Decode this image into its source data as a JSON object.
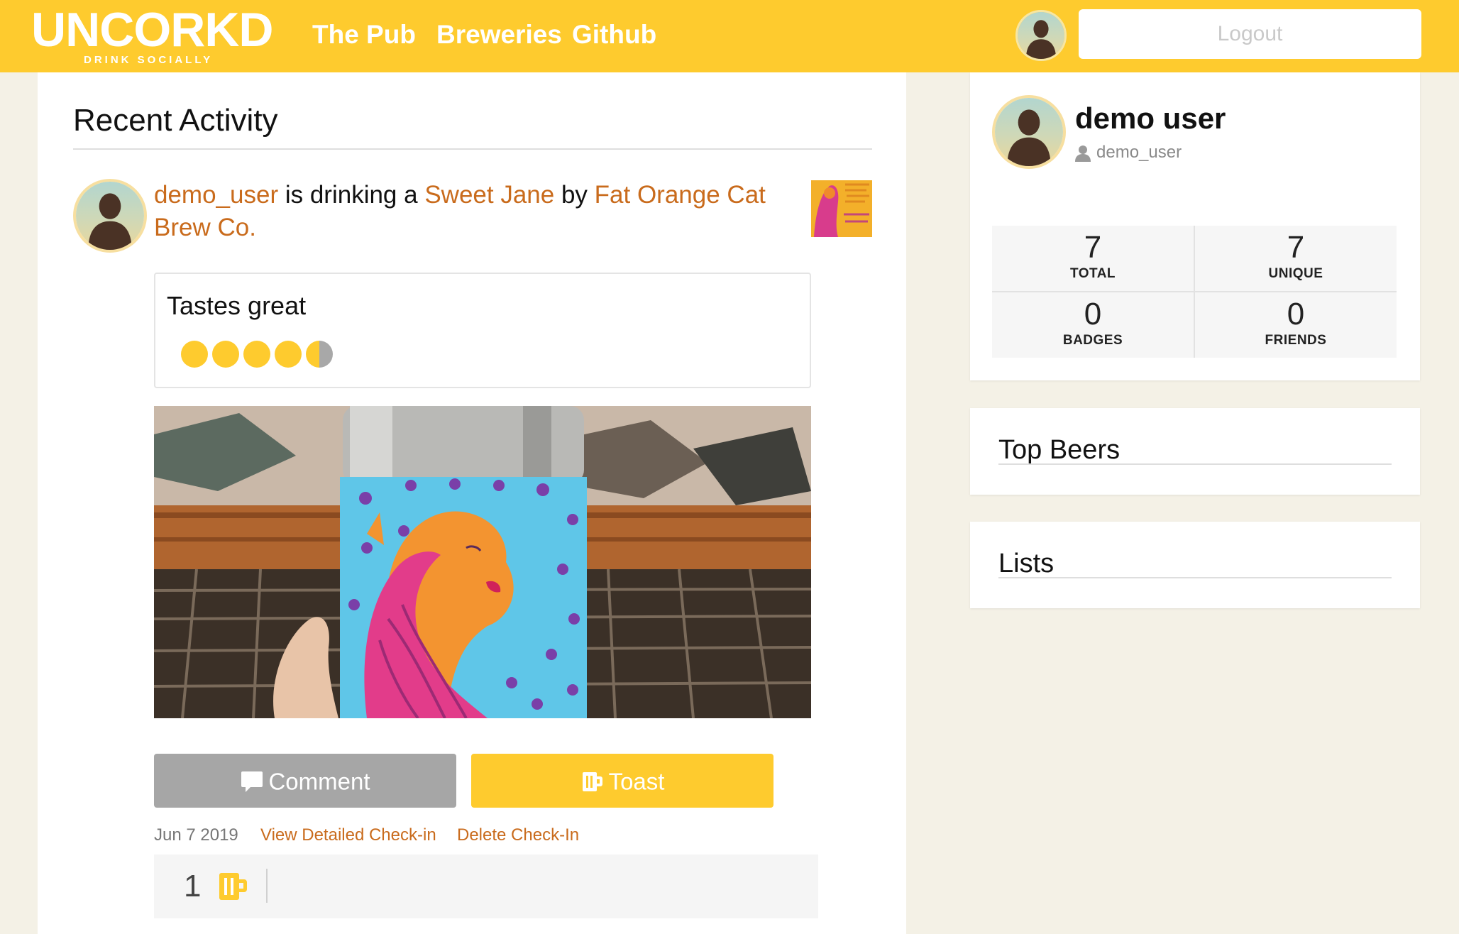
{
  "nav": {
    "logo": "UNCORKD",
    "tagline": "DRINK SOCIALLY",
    "links": [
      "The Pub",
      "Breweries",
      "Github"
    ],
    "logout_label": "Logout"
  },
  "feed": {
    "title": "Recent Activity",
    "checkin": {
      "user": "demo_user",
      "phrase_drinking": " is drinking a ",
      "beer": "Sweet Jane",
      "phrase_by": " by ",
      "brewery": "Fat Orange Cat Brew Co.",
      "review": "Tastes great",
      "rating": 4.5,
      "rating_max": 5,
      "comment_label": "Comment",
      "toast_label": "Toast",
      "date": "Jun 7 2019",
      "view_link": "View Detailed Check-in",
      "delete_link": "Delete Check-In",
      "toast_count": "1"
    }
  },
  "profile": {
    "name": "demo user",
    "handle": "demo_user",
    "stats": [
      {
        "value": "7",
        "label": "TOTAL"
      },
      {
        "value": "7",
        "label": "UNIQUE"
      },
      {
        "value": "0",
        "label": "BADGES"
      },
      {
        "value": "0",
        "label": "FRIENDS"
      }
    ]
  },
  "sidebar": {
    "top_beers_title": "Top Beers",
    "lists_title": "Lists"
  },
  "colors": {
    "brand_yellow": "#fecb2e",
    "link_orange": "#c96b1c",
    "page_bg": "#f4f1e6"
  },
  "icons": [
    "user-silhouette-icon",
    "comment-icon",
    "beer-mug-icon",
    "user-icon"
  ]
}
